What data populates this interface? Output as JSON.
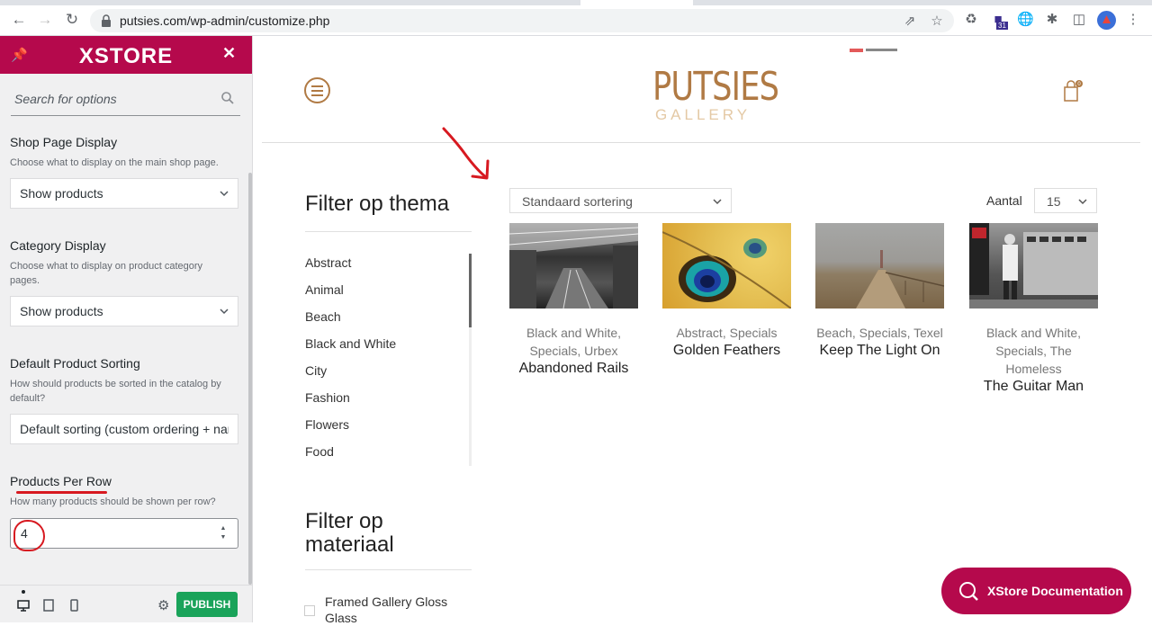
{
  "browser": {
    "url": "putsies.com/wp-admin/customize.php",
    "calendar_badge": "31"
  },
  "customizer": {
    "brand": "XSTORE",
    "search_placeholder": "Search for options",
    "options": [
      {
        "title": "Shop Page Display",
        "desc": "Choose what to display on the main shop page.",
        "value": "Show products"
      },
      {
        "title": "Category Display",
        "desc": "Choose what to display on product category pages.",
        "value": "Show products"
      },
      {
        "title": "Default Product Sorting",
        "desc": "How should products be sorted in the catalog by default?",
        "value": "Default sorting (custom ordering + name)"
      },
      {
        "title": "Products Per Row",
        "desc": "How many products should be shown per row?",
        "value": "4"
      }
    ],
    "publish_label": "PUBLISH"
  },
  "site": {
    "logo_main": "PUTSIES",
    "logo_sub": "GALLERY",
    "cart_count": "0",
    "filter_theme_title": "Filter op thema",
    "themes": [
      "Abstract",
      "Animal",
      "Beach",
      "Black and White",
      "City",
      "Fashion",
      "Flowers",
      "Food"
    ],
    "filter_material_title": "Filter op materiaal",
    "materials": [
      "Framed Gallery Gloss Glass"
    ],
    "sort_value": "Standaard sortering",
    "aantal_label": "Aantal",
    "aantal_value": "15",
    "products": [
      {
        "cats": "Black and White, Specials, Urbex",
        "name": "Abandoned Rails"
      },
      {
        "cats": "Abstract, Specials",
        "name": "Golden Feathers"
      },
      {
        "cats": "Beach, Specials, Texel",
        "name": "Keep The Light On"
      },
      {
        "cats": "Black and White, Specials, The Homeless",
        "name": "The Guitar Man"
      }
    ],
    "doc_button": "XStore Documentation"
  },
  "colors": {
    "brand": "#b5094c",
    "publish": "#1aa35a",
    "logo": "#b07a44",
    "annotation": "#d71920"
  }
}
